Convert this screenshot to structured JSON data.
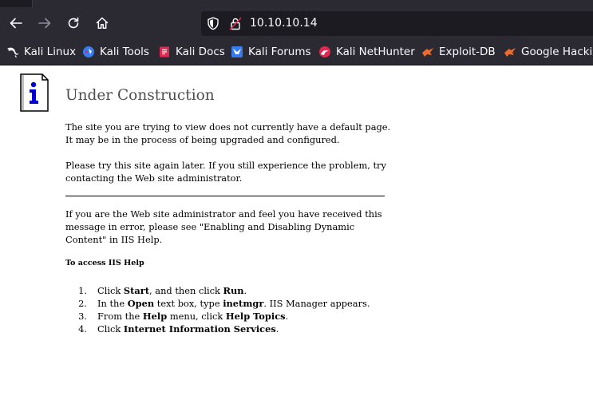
{
  "browser": {
    "url": "10.10.10.14",
    "nav_icons": [
      "back-icon",
      "forward-icon",
      "reload-icon",
      "home-icon"
    ],
    "url_icons": [
      "shield-icon",
      "insecure-lock-icon"
    ],
    "bookmarks": [
      {
        "label": "Kali Linux",
        "icon": "kali-dragon-icon"
      },
      {
        "label": "Kali Tools",
        "icon": "kali-tools-icon"
      },
      {
        "label": "Kali Docs",
        "icon": "kali-docs-icon"
      },
      {
        "label": "Kali Forums",
        "icon": "kali-forums-icon"
      },
      {
        "label": "Kali NetHunter",
        "icon": "kali-nethunter-icon"
      },
      {
        "label": "Exploit-DB",
        "icon": "exploit-db-icon"
      },
      {
        "label": "Google Hackin",
        "icon": "google-hacking-icon"
      }
    ]
  },
  "page": {
    "title": "Under Construction",
    "para1_line1": "The site you are trying to view does not currently have a default page.",
    "para1_line2": "It may be in the process of being upgraded and configured.",
    "para2_line1": "Please try this site again later. If you still experience the problem, try",
    "para2_line2": "contacting the Web site administrator.",
    "para3_line1": "If you are the Web site administrator and feel you have received this",
    "para3_line2": "message in error, please see \"Enabling and Disabling Dynamic",
    "para3_line3": "Content\" in IIS Help.",
    "subheading": "To access IIS Help",
    "steps": [
      {
        "num": "1.",
        "a": "Click ",
        "b1": "Start",
        "c": ", and then click ",
        "b2": "Run",
        "d": "."
      },
      {
        "num": "2.",
        "a": "In the ",
        "b1": "Open",
        "c": " text box, type ",
        "b2": "inetmgr",
        "d": ". IIS Manager appears."
      },
      {
        "num": "3.",
        "a": "From the ",
        "b1": "Help",
        "c": " menu, click ",
        "b2": "Help Topics",
        "d": "."
      },
      {
        "num": "4.",
        "a": "Click ",
        "b1": "Internet Information Services",
        "c": ".",
        "b2": "",
        "d": ""
      }
    ]
  }
}
